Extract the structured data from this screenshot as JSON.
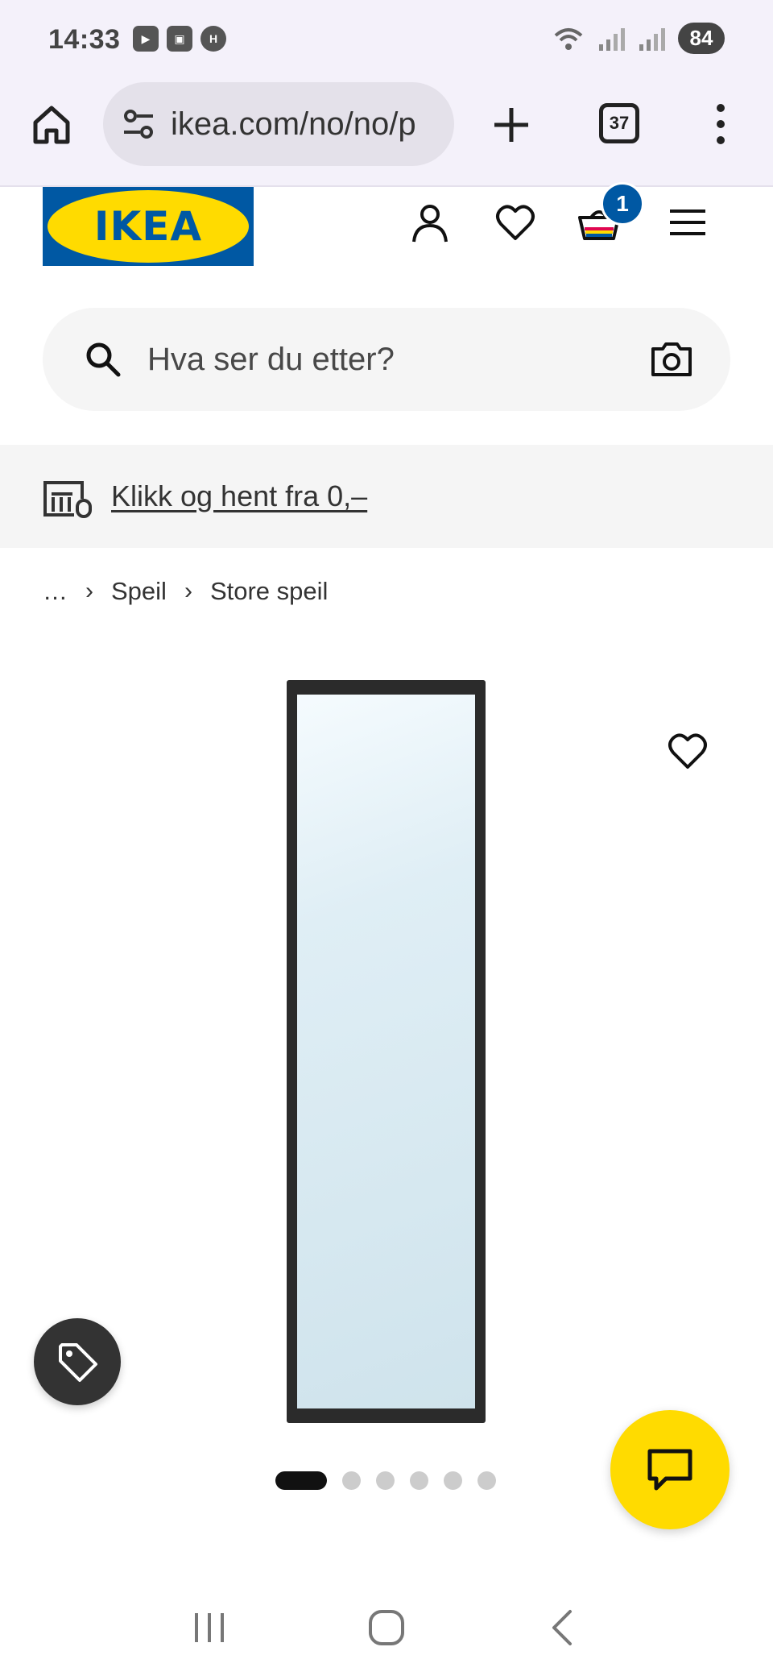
{
  "status_bar": {
    "time": "14:33",
    "battery": "84",
    "icons": [
      "youtube-icon",
      "screenshot-icon",
      "hm-icon",
      "wifi-icon",
      "signal-icon",
      "signal-icon"
    ]
  },
  "browser": {
    "url": "ikea.com/no/no/p",
    "tab_count": "37"
  },
  "header": {
    "logo_text": "IKEA",
    "cart_count": "1",
    "colors": {
      "brand_blue": "#0058a3",
      "brand_yellow": "#ffdb00"
    }
  },
  "search": {
    "placeholder": "Hva ser du etter?"
  },
  "promo": {
    "text": "Klikk og hent fra 0,–"
  },
  "breadcrumb": {
    "items": [
      "…",
      "Speil",
      "Store speil"
    ]
  },
  "carousel": {
    "total": 6,
    "active_index": 0
  }
}
